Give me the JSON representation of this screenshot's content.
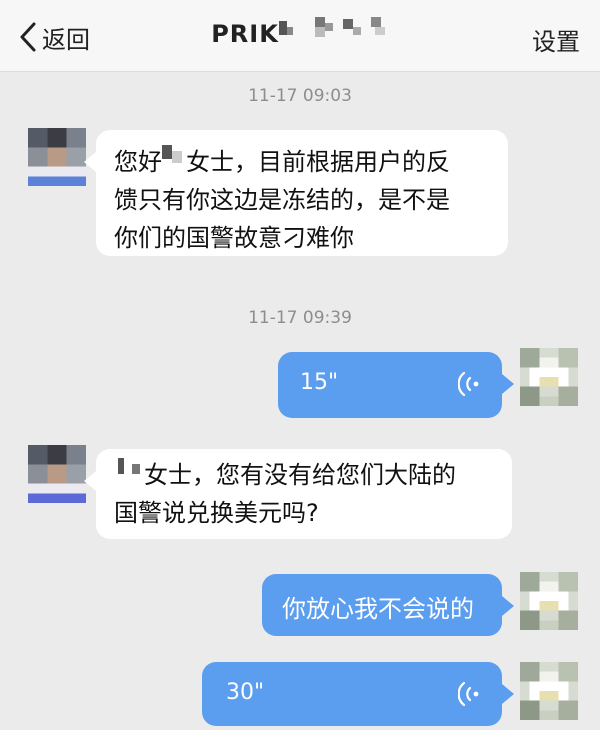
{
  "header": {
    "back_label": "返回",
    "title": "PRIK",
    "settings_label": "设置"
  },
  "messages": [
    {
      "type": "timestamp",
      "text": "11-17 09:03"
    },
    {
      "type": "incoming",
      "lines": [
        "您好",
        "女士，目前根据用户的反",
        "馈只有你这边是冻结的，是不是",
        "你们的国警故意刁难你"
      ]
    },
    {
      "type": "timestamp",
      "text": "11-17 09:39"
    },
    {
      "type": "outgoing_voice",
      "duration": "15\""
    },
    {
      "type": "incoming",
      "lines": [
        "女士，您有没有给您们大陆的",
        "国警说兑换美元吗?"
      ]
    },
    {
      "type": "outgoing",
      "text": "你放心我不会说的"
    },
    {
      "type": "outgoing_voice",
      "duration": "30\""
    }
  ],
  "icons": {
    "back": "chevron-left-icon",
    "voice": "voice-wave-icon"
  },
  "colors": {
    "outgoing_bubble": "#5b9dee",
    "incoming_bubble": "#ffffff",
    "background": "#ebebeb"
  }
}
